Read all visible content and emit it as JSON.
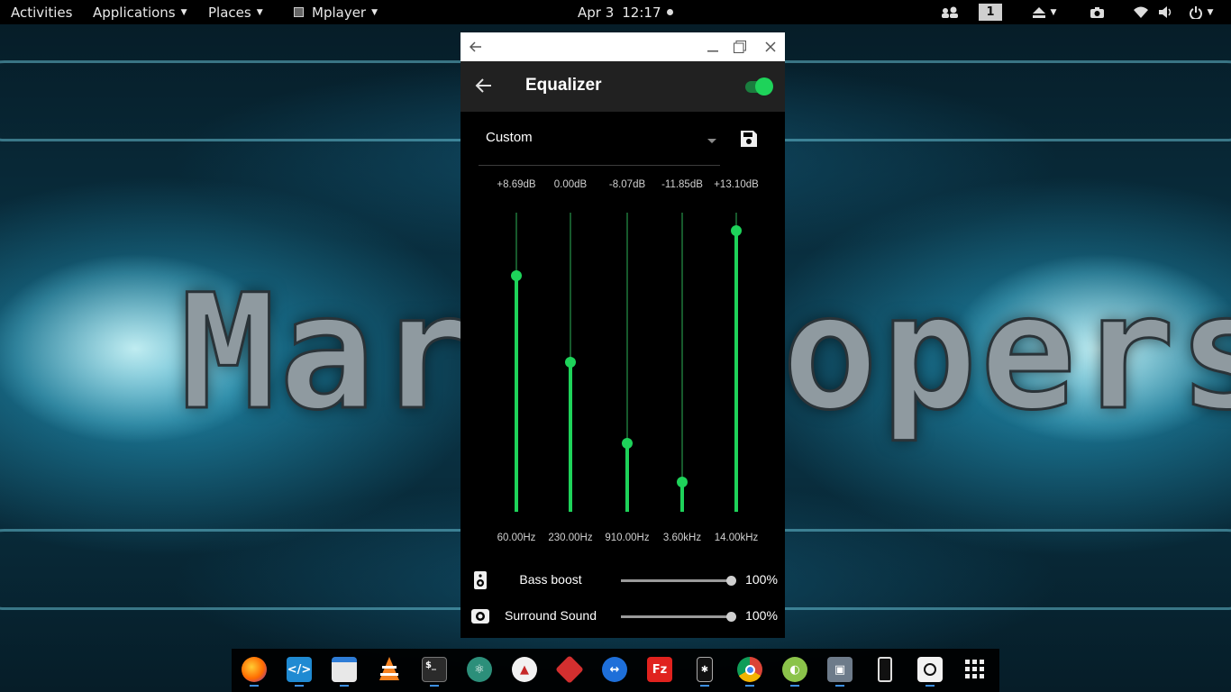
{
  "topbar": {
    "activities": "Activities",
    "applications": "Applications",
    "places": "Places",
    "app_menu": "Mplayer",
    "date": "Apr 3",
    "time": "12:17",
    "workspace": "1",
    "tray_icons": [
      "network-people-icon",
      "eject-icon",
      "screenshot-icon",
      "wifi-icon",
      "volume-icon",
      "power-icon"
    ]
  },
  "window": {
    "titlebar_icons": [
      "back-arrow-icon",
      "minimize-icon",
      "maximize-icon",
      "close-icon"
    ],
    "appbar": {
      "title": "Equalizer",
      "enabled": true
    },
    "preset": {
      "selected": "Custom"
    },
    "bands": [
      {
        "gain": "+8.69dB",
        "freq": "60.00Hz",
        "level": 0.79
      },
      {
        "gain": "0.00dB",
        "freq": "230.00Hz",
        "level": 0.5
      },
      {
        "gain": "-8.07dB",
        "freq": "910.00Hz",
        "level": 0.23
      },
      {
        "gain": "-11.85dB",
        "freq": "3.60kHz",
        "level": 0.1
      },
      {
        "gain": "+13.10dB",
        "freq": "14.00kHz",
        "level": 0.94
      }
    ],
    "effects": [
      {
        "label": "Bass boost",
        "value": "100%",
        "level": 1.0,
        "icon": "speaker-icon"
      },
      {
        "label": "Surround Sound",
        "value": "100%",
        "level": 1.0,
        "icon": "surround-icon"
      }
    ]
  },
  "dock": {
    "apps": [
      "firefox-icon",
      "vscode-icon",
      "files-icon",
      "vlc-icon",
      "terminal-icon",
      "atom-icon",
      "app-icon",
      "app-red-icon",
      "teamviewer-icon",
      "filezilla-icon",
      "phone-app-icon",
      "chrome-icon",
      "android-icon",
      "box-icon",
      "phone-icon",
      "circle-app-icon",
      "app-grid-icon"
    ]
  },
  "colors": {
    "accent": "#1ed35a",
    "topbar": "#000000",
    "appbar": "#212121",
    "window_bg": "#000000"
  }
}
